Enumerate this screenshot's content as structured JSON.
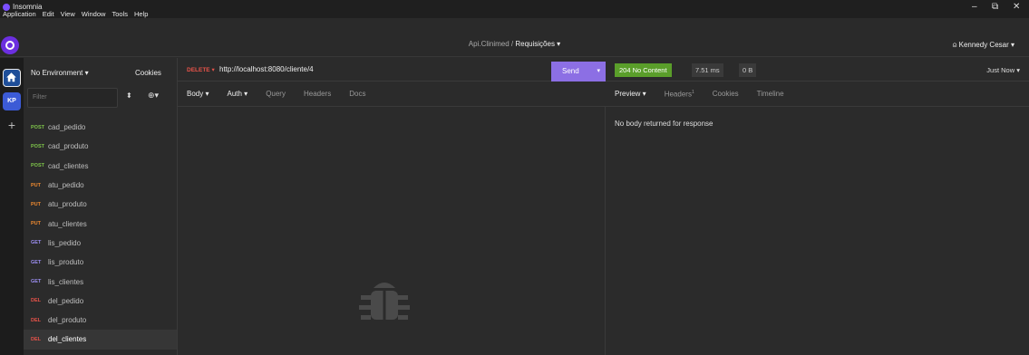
{
  "window": {
    "title": "Insomnia",
    "menu": [
      "Application",
      "Edit",
      "View",
      "Window",
      "Tools",
      "Help"
    ]
  },
  "header": {
    "breadcrumb_parent": "Api.Clinimed",
    "breadcrumb_sep": " / ",
    "breadcrumb_current": "Requisições ▾",
    "user": "⍝ Kennedy Cesar ▾"
  },
  "rail": {
    "workspace_badge": "KP"
  },
  "sidebar": {
    "environment": "No Environment ▾",
    "cookies": "Cookies",
    "filter_placeholder": "Filter",
    "requests": [
      {
        "method": "POST",
        "name": "cad_pedido",
        "kind": "post"
      },
      {
        "method": "POST",
        "name": "cad_produto",
        "kind": "post"
      },
      {
        "method": "POST",
        "name": "cad_clientes",
        "kind": "post"
      },
      {
        "method": "PUT",
        "name": "atu_pedido",
        "kind": "put"
      },
      {
        "method": "PUT",
        "name": "atu_produto",
        "kind": "put"
      },
      {
        "method": "PUT",
        "name": "atu_clientes",
        "kind": "put"
      },
      {
        "method": "GET",
        "name": "lis_pedido",
        "kind": "get"
      },
      {
        "method": "GET",
        "name": "lis_produto",
        "kind": "get"
      },
      {
        "method": "GET",
        "name": "lis_clientes",
        "kind": "get"
      },
      {
        "method": "DEL",
        "name": "del_pedido",
        "kind": "del"
      },
      {
        "method": "DEL",
        "name": "del_produto",
        "kind": "del"
      },
      {
        "method": "DEL",
        "name": "del_clientes",
        "kind": "del",
        "active": true
      }
    ]
  },
  "request": {
    "method": "DELETE ▾",
    "url": "http://localhost:8080/cliente/4",
    "send_label": "Send",
    "tabs": [
      "Body ▾",
      "Auth ▾",
      "Query",
      "Headers",
      "Docs"
    ]
  },
  "response": {
    "status": "204 No Content",
    "time": "7.51 ms",
    "size": "0 B",
    "timestamp": "Just Now ▾",
    "tabs": [
      "Preview ▾",
      "Headers",
      "Cookies",
      "Timeline"
    ],
    "headers_count": "1",
    "empty_message": "No body returned for response"
  },
  "colors": {
    "accent": "#8c6fe4",
    "status_ok": "#5a9e2a",
    "post": "#7ec44a",
    "put": "#ee8a30",
    "get": "#9c8ef2",
    "delete": "#e8534a"
  }
}
